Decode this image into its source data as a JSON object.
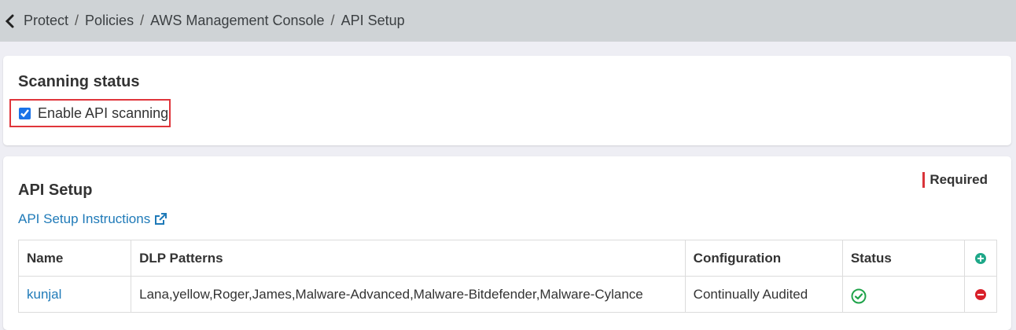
{
  "breadcrumb": {
    "items": [
      "Protect",
      "Policies",
      "AWS Management Console",
      "API Setup"
    ],
    "separator": "/"
  },
  "scanning": {
    "title": "Scanning status",
    "enable_label": "Enable API scanning",
    "enabled": true
  },
  "api_setup": {
    "title": "API Setup",
    "required_label": "Required",
    "instructions_link": "API Setup Instructions",
    "table": {
      "headers": [
        "Name",
        "DLP Patterns",
        "Configuration",
        "Status"
      ],
      "rows": [
        {
          "name": "kunjal",
          "dlp_patterns": "Lana,yellow,Roger,James,Malware-Advanced,Malware-Bitdefender,Malware-Cylance",
          "configuration": "Continually Audited",
          "status_icon": "check-circle-icon"
        }
      ]
    }
  },
  "colors": {
    "accent": "#1f7ab8",
    "highlight_border": "#e0353b",
    "success": "#1fa34a",
    "danger": "#d9202a",
    "add": "#1fa889"
  }
}
